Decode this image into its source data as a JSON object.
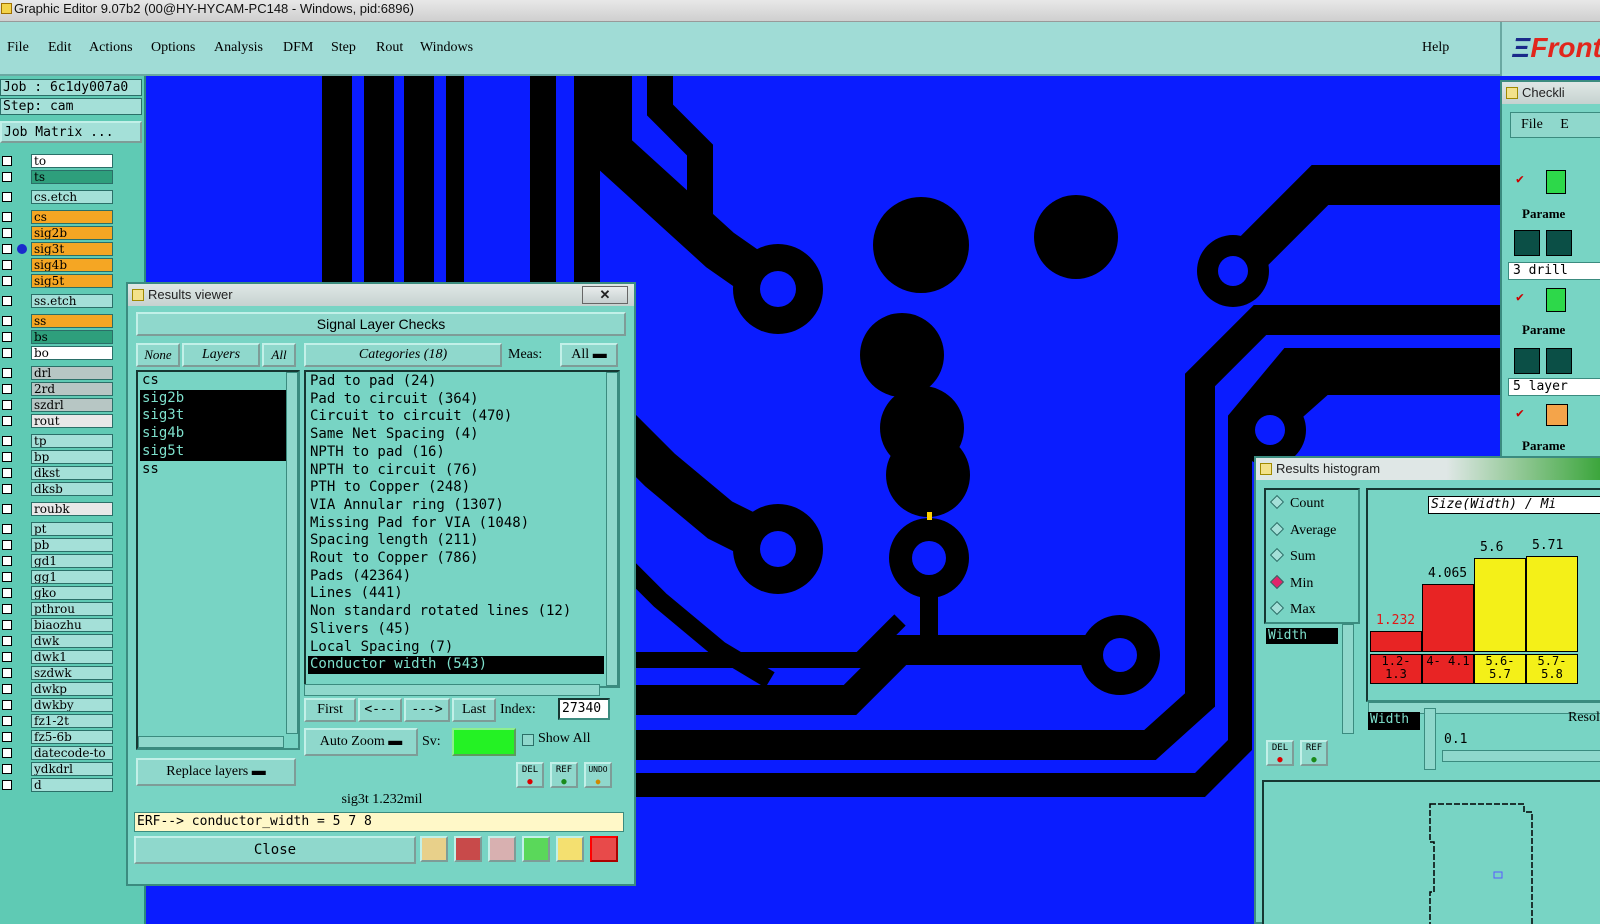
{
  "titlebar": {
    "title": "Graphic Editor 9.07b2 (00@HY-HYCAM-PC148 - Windows, pid:6896)"
  },
  "menubar": {
    "items": [
      "File",
      "Edit",
      "Actions",
      "Options",
      "Analysis",
      "DFM",
      "Step",
      "Rout",
      "Windows"
    ],
    "help": "Help",
    "logo": "Front"
  },
  "left": {
    "job": "Job : 6c1dy007a0",
    "step": "Step: cam",
    "job_matrix": "Job Matrix ...",
    "layers": [
      {
        "name": "to",
        "color": "#ffffff"
      },
      {
        "name": "ts",
        "color": "#2e9f7c"
      },
      {
        "name": "cs.etch",
        "color": "#a4e0d8"
      },
      {
        "name": "cs",
        "color": "#f5a623"
      },
      {
        "name": "sig2b",
        "color": "#f5a623"
      },
      {
        "name": "sig3t",
        "color": "#f5a623"
      },
      {
        "name": "sig4b",
        "color": "#f5a623"
      },
      {
        "name": "sig5t",
        "color": "#f5a623"
      },
      {
        "name": "ss.etch",
        "color": "#a4e0d8"
      },
      {
        "name": "ss",
        "color": "#f5a623"
      },
      {
        "name": "bs",
        "color": "#2e9f7c"
      },
      {
        "name": "bo",
        "color": "#ffffff"
      },
      {
        "name": "drl",
        "color": "#b7c6c4"
      },
      {
        "name": "2rd",
        "color": "#b7c6c4"
      },
      {
        "name": "szdrl",
        "color": "#b7c6c4"
      },
      {
        "name": "rout",
        "color": "#e8e8e8"
      },
      {
        "name": "tp",
        "color": "#a4e0d8"
      },
      {
        "name": "bp",
        "color": "#a4e0d8"
      },
      {
        "name": "dkst",
        "color": "#a4e0d8"
      },
      {
        "name": "dksb",
        "color": "#a4e0d8"
      },
      {
        "name": "roubk",
        "color": "#e8e8e8"
      },
      {
        "name": "pt",
        "color": "#a4e0d8"
      },
      {
        "name": "pb",
        "color": "#a4e0d8"
      },
      {
        "name": "gd1",
        "color": "#a4e0d8"
      },
      {
        "name": "gg1",
        "color": "#a4e0d8"
      },
      {
        "name": "gko",
        "color": "#a4e0d8"
      },
      {
        "name": "pthrou",
        "color": "#a4e0d8"
      },
      {
        "name": "biaozhu",
        "color": "#a4e0d8"
      },
      {
        "name": "dwk",
        "color": "#a4e0d8"
      },
      {
        "name": "dwk1",
        "color": "#a4e0d8"
      },
      {
        "name": "szdwk",
        "color": "#a4e0d8"
      },
      {
        "name": "dwkp",
        "color": "#a4e0d8"
      },
      {
        "name": "dwkby",
        "color": "#a4e0d8"
      },
      {
        "name": "fz1-2t",
        "color": "#a4e0d8"
      },
      {
        "name": "fz5-6b",
        "color": "#a4e0d8"
      },
      {
        "name": "datecode-to",
        "color": "#a4e0d8"
      },
      {
        "name": "ydkdrl",
        "color": "#a4e0d8"
      },
      {
        "name": "d",
        "color": "#a4e0d8"
      }
    ]
  },
  "results_viewer": {
    "title": "Results viewer",
    "close_x": "✕",
    "header": "Signal Layer Checks",
    "none": "None",
    "layers_label": "Layers",
    "all": "All",
    "categories": "Categories (18)",
    "meas_label": "Meas:",
    "meas_value": "All",
    "layer_list": [
      "cs",
      "sig2b",
      "sig3t",
      "sig4b",
      "sig5t",
      "ss"
    ],
    "checks": [
      "Pad to pad (24)",
      "Pad to circuit (364)",
      "Circuit to circuit (470)",
      "Same Net Spacing (4)",
      "NPTH to pad (16)",
      "NPTH to circuit (76)",
      "PTH to Copper (248)",
      "VIA Annular ring (1307)",
      "Missing Pad for VIA (1048)",
      "Spacing length (211)",
      "Rout to Copper (786)",
      "Pads (42364)",
      "Lines (441)",
      "Non standard rotated lines (12)",
      "Slivers (45)",
      "Local Spacing (7)",
      "Conductor width (543)"
    ],
    "nav": {
      "first": "First",
      "prev": "<---",
      "next": "--->",
      "last": "Last",
      "index_label": "Index:",
      "index_value": "27340"
    },
    "auto_zoom": "Auto Zoom",
    "sv_label": "Sv:",
    "show_all": "Show All",
    "replace_layers": "Replace layers",
    "del": "DEL",
    "ref": "REF",
    "undo": "UNDO",
    "status": "sig3t 1.232mil",
    "erf": "ERF--> conductor_width = 5 7 8",
    "close": "Close"
  },
  "checklist": {
    "title": "Checkli",
    "file": "File",
    "edit": "E",
    "param1": "Parame",
    "param2": "Parame",
    "param3": "Parame",
    "drill": "3 drill",
    "layer": "5 layer"
  },
  "histogram": {
    "title": "Results histogram",
    "options": [
      "Count",
      "Average",
      "Sum",
      "Min",
      "Max"
    ],
    "selected_option": "Min",
    "attr": "Width",
    "chart_title": "Size(Width) / Mi",
    "bars": [
      {
        "value": "1.232",
        "range": "1.2- 1.3",
        "color": "#e82424"
      },
      {
        "value": "4.065",
        "range": "4- 4.1",
        "color": "#e82424"
      },
      {
        "value": "5.6",
        "range": "5.6- 5.7",
        "color": "#f4f018"
      },
      {
        "value": "5.71",
        "range": "5.7- 5.8",
        "color": "#f4f018"
      }
    ],
    "width_box": "Width",
    "resol_label": "Resol",
    "resol_value": "0.1",
    "del": "DEL",
    "ref": "REF"
  }
}
